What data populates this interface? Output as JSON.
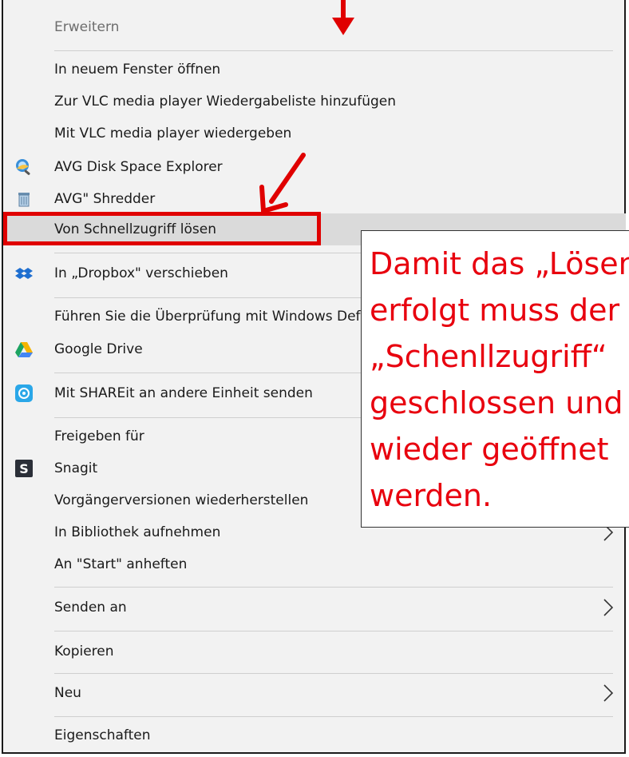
{
  "menu": {
    "items": [
      {
        "label": "Erweitern",
        "icon": "",
        "disabled": true
      },
      {
        "label": "In neuem Fenster öffnen",
        "icon": ""
      },
      {
        "label": "Zur VLC media player Wiedergabeliste hinzufügen",
        "icon": ""
      },
      {
        "label": "Mit VLC media player wiedergeben",
        "icon": ""
      },
      {
        "label": "AVG Disk Space Explorer",
        "icon": "avg-disk-icon"
      },
      {
        "label": "AVG\" Shredder",
        "icon": "avg-shredder-icon"
      },
      {
        "label": "Von Schnellzugriff lösen",
        "icon": "",
        "highlighted": true
      },
      {
        "label": "In „Dropbox\" verschieben",
        "icon": "dropbox-icon"
      },
      {
        "label": "Führen Sie die Überprüfung mit Windows Defender durch...",
        "icon": ""
      },
      {
        "label": "Google Drive",
        "icon": "google-drive-icon"
      },
      {
        "label": "Mit SHAREit an andere Einheit senden",
        "icon": "shareit-icon"
      },
      {
        "label": "Freigeben für",
        "icon": ""
      },
      {
        "label": "Snagit",
        "icon": "snagit-icon"
      },
      {
        "label": "Vorgängerversionen wiederherstellen",
        "icon": ""
      },
      {
        "label": "In Bibliothek aufnehmen",
        "icon": "",
        "submenu": true
      },
      {
        "label": "An \"Start\" anheften",
        "icon": ""
      },
      {
        "label": "Senden an",
        "icon": "",
        "submenu": true
      },
      {
        "label": "Kopieren",
        "icon": ""
      },
      {
        "label": "Neu",
        "icon": "",
        "submenu": true
      },
      {
        "label": "Eigenschaften",
        "icon": ""
      }
    ]
  },
  "callout": {
    "lines": [
      "Damit das „Lösen“",
      "erfolgt muss der",
      "„Schenllzugriff“",
      "geschlossen und",
      "wieder geöffnet",
      "werden."
    ]
  },
  "colors": {
    "annotation_red": "#e00000",
    "menu_bg": "#f2f2f2",
    "highlight": "#dadada"
  }
}
